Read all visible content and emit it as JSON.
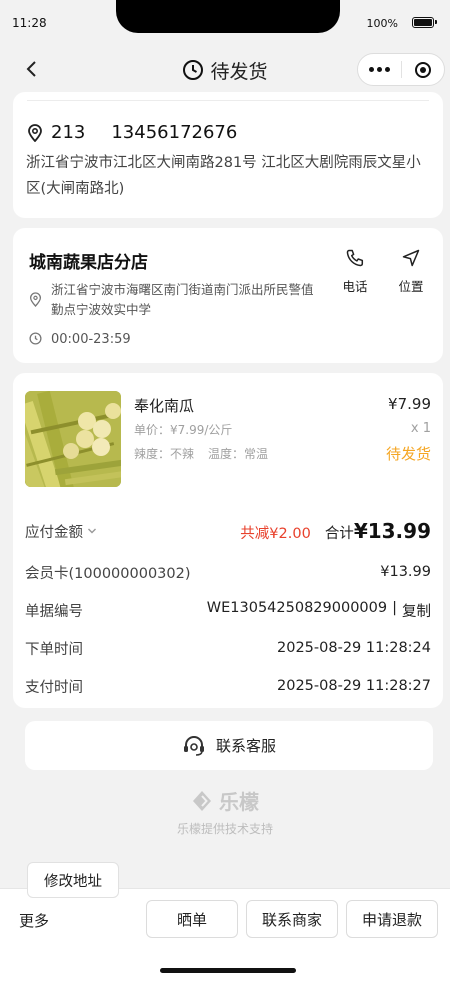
{
  "status_bar": {
    "time": "11:28",
    "battery": "100%",
    "battery_level": 1.0
  },
  "nav": {
    "title": "待发货",
    "back_icon": "chevron-left-icon",
    "title_icon": "clock-icon"
  },
  "address": {
    "name": "213",
    "phone": "13456172676",
    "detail": "浙江省宁波市江北区大闸南路281号 江北区大剧院雨辰文星小区(大闸南路北)"
  },
  "shop": {
    "name": "城南蔬果店分店",
    "address": "浙江省宁波市海曙区南门街道南门派出所民警值勤点宁波效实中学",
    "hours": "00:00-23:59",
    "phone_label": "电话",
    "location_label": "位置"
  },
  "product": {
    "name": "奉化南瓜",
    "price": "¥7.99",
    "unit_price": "单价：¥7.99/公斤",
    "quantity": "x 1",
    "spice": "辣度：不辣",
    "temperature": "温度：常温",
    "status": "待发货"
  },
  "summary": {
    "payable_label": "应付金额",
    "discount": "共减¥2.00",
    "total_label": "合计",
    "total_value": "¥13.99",
    "member_card_label": "会员卡(100000000302)",
    "member_card_value": "¥13.99",
    "order_no_label": "单据编号",
    "order_no_value": "WE13054250829000009",
    "copy_label": "复制",
    "order_time_label": "下单时间",
    "order_time_value": "2025-08-29 11:28:24",
    "pay_time_label": "支付时间",
    "pay_time_value": "2025-08-29 11:28:27"
  },
  "customer_service": {
    "label": "联系客服"
  },
  "footer": {
    "brand": "乐檬",
    "powered_by": "乐檬提供技术支持"
  },
  "actions": {
    "modify_address": "修改地址",
    "more": "更多",
    "share_order": "晒单",
    "contact_merchant": "联系商家",
    "refund": "申请退款"
  },
  "colors": {
    "accent_red": "#e8412c",
    "status_orange": "#f5a623"
  }
}
